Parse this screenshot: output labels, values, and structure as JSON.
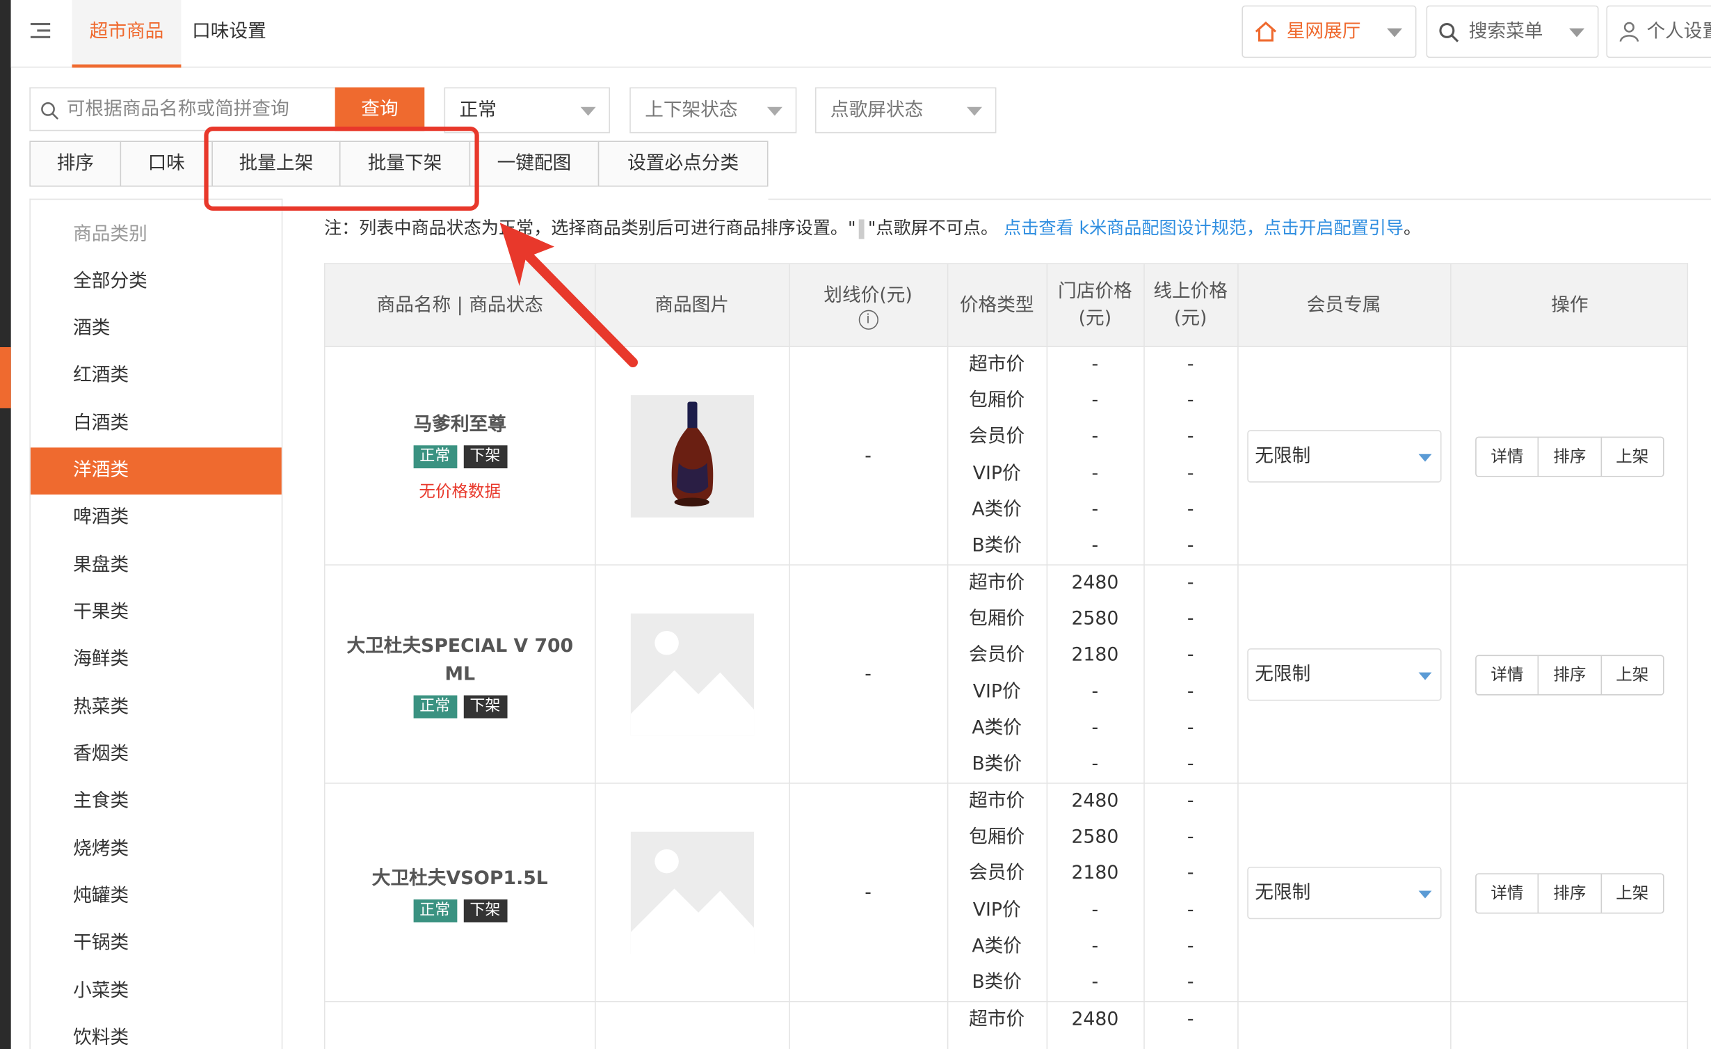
{
  "header": {
    "tabs": [
      {
        "label": "超市商品"
      },
      {
        "label": "口味设置"
      }
    ],
    "store_label": "星网展厅",
    "search_menu_label": "搜索菜单",
    "profile_label": "个人设置"
  },
  "filters": {
    "search_placeholder": "可根据商品名称或简拼查询",
    "query_label": "查询",
    "status_value": "正常",
    "shelf_placeholder": "上下架状态",
    "screen_placeholder": "点歌屏状态"
  },
  "actions": {
    "sort": "排序",
    "flavor": "口味",
    "batch_on": "批量上架",
    "batch_off": "批量下架",
    "auto_image": "一键配图",
    "must_category": "设置必点分类"
  },
  "sidebar": {
    "header": "商品类别",
    "items": [
      "全部分类",
      "酒类",
      "红酒类",
      "白酒类",
      "洋酒类",
      "啤酒类",
      "果盘类",
      "干果类",
      "海鲜类",
      "热菜类",
      "香烟类",
      "主食类",
      "烧烤类",
      "炖罐类",
      "干锅类",
      "小菜类",
      "饮料类"
    ],
    "active_index": 4
  },
  "note": {
    "prefix": "注：列表中商品状态为正常，选择商品类别后可进行商品排序设置。\"",
    "middle": "\"点歌屏不可点。",
    "link1": "点击查看 k米商品配图设计规范，",
    "link2": "点击开启配置引导",
    "suffix": "。"
  },
  "table": {
    "headers": {
      "name": "商品名称 | 商品状态",
      "image": "商品图片",
      "strike_price": "划线价(元)",
      "price_type": "价格类型",
      "store_price_1": "门店价格",
      "store_price_2": "(元)",
      "online_price_1": "线上价格",
      "online_price_2": "(元)",
      "member": "会员专属",
      "ops": "操作"
    },
    "info_icon": "i",
    "price_types": [
      "超市价",
      "包厢价",
      "会员价",
      "VIP价",
      "A类价",
      "B类价"
    ],
    "rows": [
      {
        "name": "马爹利至尊",
        "status": "正常",
        "shelf": "下架",
        "note": "无价格数据",
        "strike": "-",
        "image": "bottle-photo",
        "store_prices": [
          "-",
          "-",
          "-",
          "-",
          "-",
          "-"
        ],
        "online_prices": [
          "-",
          "-",
          "-",
          "-",
          "-",
          "-"
        ],
        "member": "无限制",
        "ops": [
          "详情",
          "排序",
          "上架"
        ]
      },
      {
        "name_line1": "大卫杜夫SPECIAL V 700",
        "name_line2": "ML",
        "status": "正常",
        "shelf": "下架",
        "strike": "-",
        "image": "placeholder-image",
        "store_prices": [
          "2480",
          "2580",
          "2180",
          "-",
          "-",
          "-"
        ],
        "online_prices": [
          "-",
          "-",
          "-",
          "-",
          "-",
          "-"
        ],
        "member": "无限制",
        "ops": [
          "详情",
          "排序",
          "上架"
        ]
      },
      {
        "name": "大卫杜夫VSOP1.5L",
        "status": "正常",
        "shelf": "下架",
        "strike": "-",
        "image": "placeholder-image",
        "store_prices": [
          "2480",
          "2580",
          "2180",
          "-",
          "-",
          "-"
        ],
        "online_prices": [
          "-",
          "-",
          "-",
          "-",
          "-",
          "-"
        ],
        "member": "无限制",
        "ops": [
          "详情",
          "排序",
          "上架"
        ]
      },
      {
        "partial_type": "超市价",
        "partial_store": "2480",
        "partial_online": "-"
      }
    ]
  },
  "colors": {
    "accent": "#ef6a2f",
    "annotation": "#e8382b",
    "badge_green": "#3a9281",
    "badge_dark": "#333333",
    "link": "#2f8ee0"
  }
}
